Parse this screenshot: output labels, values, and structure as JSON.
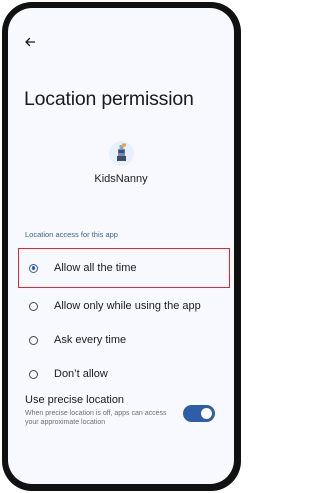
{
  "header": {
    "back_icon": "arrow-back-icon",
    "title": "Location permission"
  },
  "app": {
    "icon": "kidsnanny-app-icon",
    "name": "KidsNanny"
  },
  "location_access": {
    "section_label": "Location access for this app",
    "options": [
      {
        "label": "Allow all the time",
        "selected": true
      },
      {
        "label": "Allow only while using the app",
        "selected": false
      },
      {
        "label": "Ask every time",
        "selected": false
      },
      {
        "label": "Don’t allow",
        "selected": false
      }
    ],
    "highlight_color": "#e5262a"
  },
  "precise_location": {
    "title": "Use precise location",
    "description": "When precise location is off, apps can access your approximate location",
    "enabled": true
  },
  "colors": {
    "accent": "#2f5ea8",
    "background": "#f7f9ff",
    "section_label": "#3f5f90"
  }
}
